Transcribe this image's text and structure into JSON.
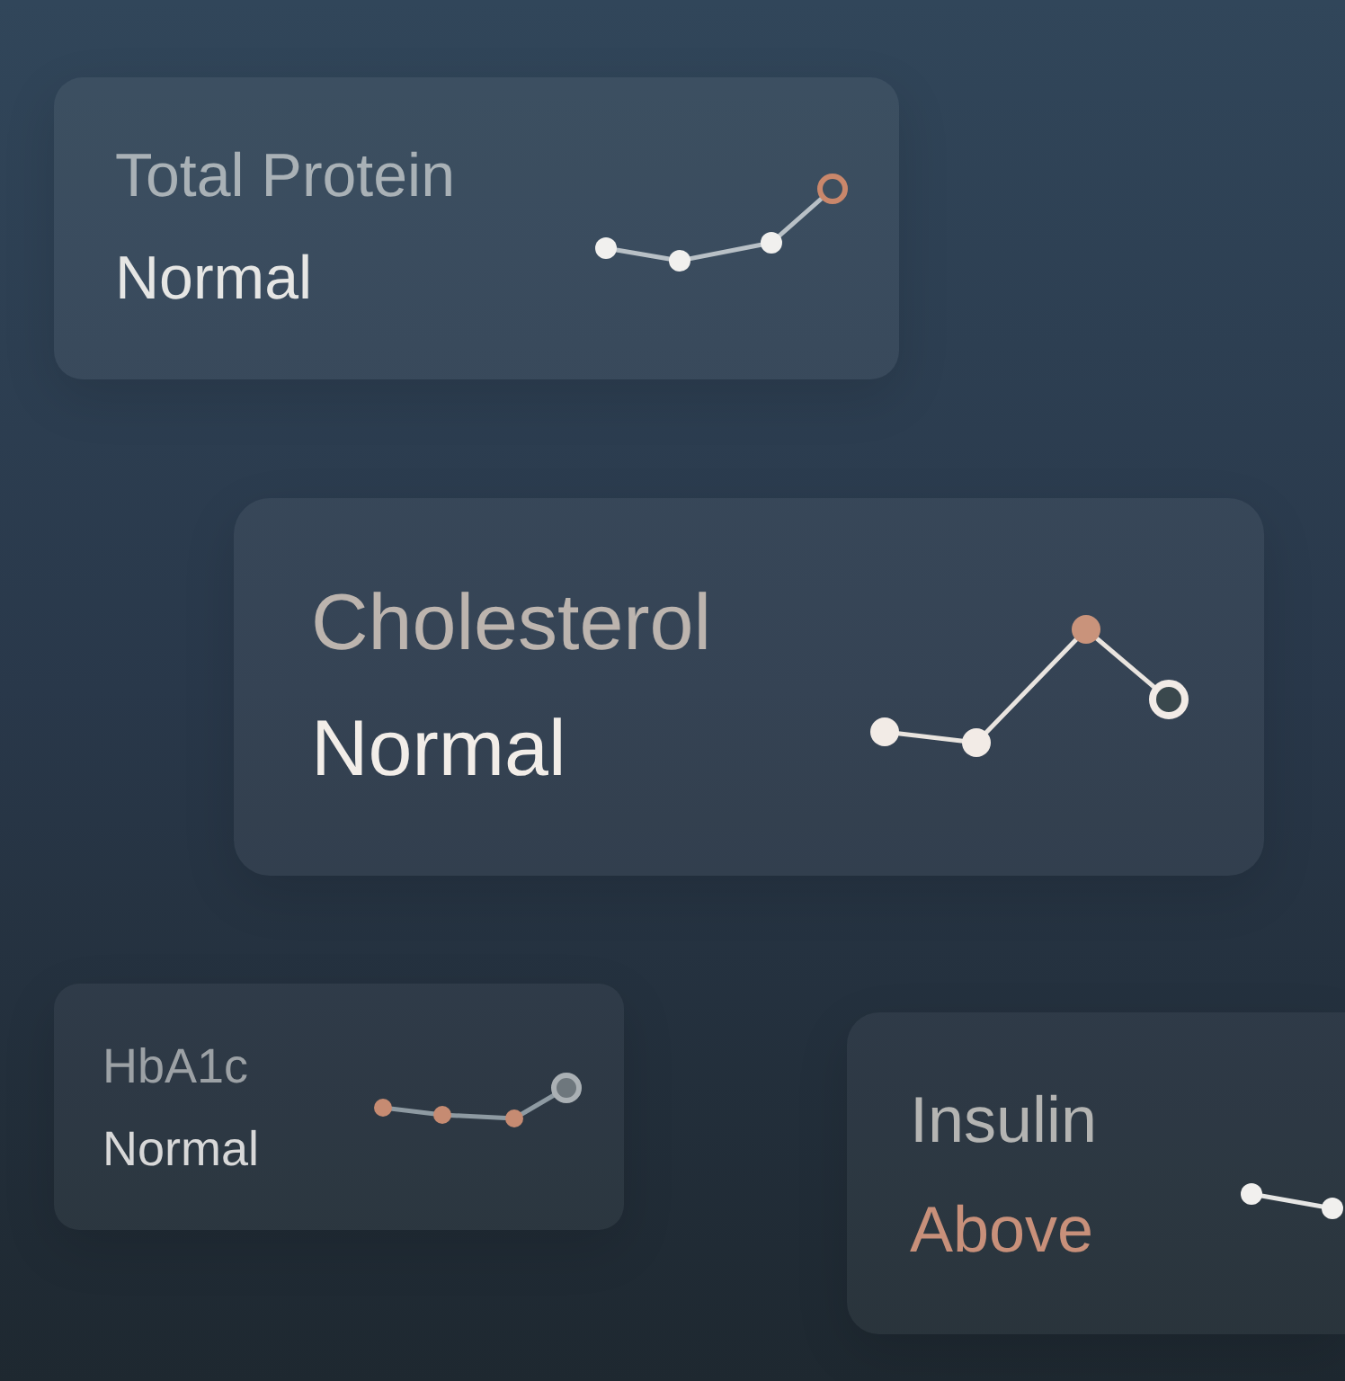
{
  "cards": [
    {
      "title": "Total Protein",
      "status": "Normal",
      "color": "#e6e6e4"
    },
    {
      "title": "Cholesterol",
      "status": "Normal",
      "color": "#f2ede8"
    },
    {
      "title": "HbA1c",
      "status": "Normal",
      "color": "#d8d8d8"
    },
    {
      "title": "Insulin",
      "status": "Above",
      "color": "#c8907a"
    }
  ]
}
